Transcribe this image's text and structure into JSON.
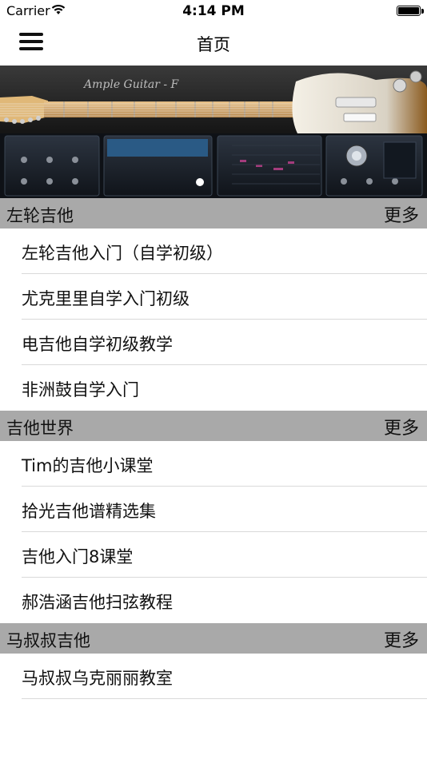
{
  "status_bar": {
    "carrier": "Carrier",
    "time": "4:14 PM"
  },
  "nav": {
    "title": "首页",
    "menu_icon": "hamburger-icon"
  },
  "banner": {
    "logo_text": "Ample Guitar - F",
    "icon": "guitar-plugin-image"
  },
  "sections": [
    {
      "title": "左轮吉他",
      "more": "更多",
      "items": [
        "左轮吉他入门（自学初级）",
        "尤克里里自学入门初级",
        "电吉他自学初级教学",
        "非洲鼓自学入门"
      ]
    },
    {
      "title": "吉他世界",
      "more": "更多",
      "items": [
        "Tim的吉他小课堂",
        "拾光吉他谱精选集",
        "吉他入门8课堂",
        "郝浩涵吉他扫弦教程"
      ]
    },
    {
      "title": "马叔叔吉他",
      "more": "更多",
      "items": [
        "马叔叔乌克丽丽教室"
      ]
    }
  ],
  "colors": {
    "section_header_bg": "#a9a9a9",
    "divider": "#d9d9d9"
  }
}
